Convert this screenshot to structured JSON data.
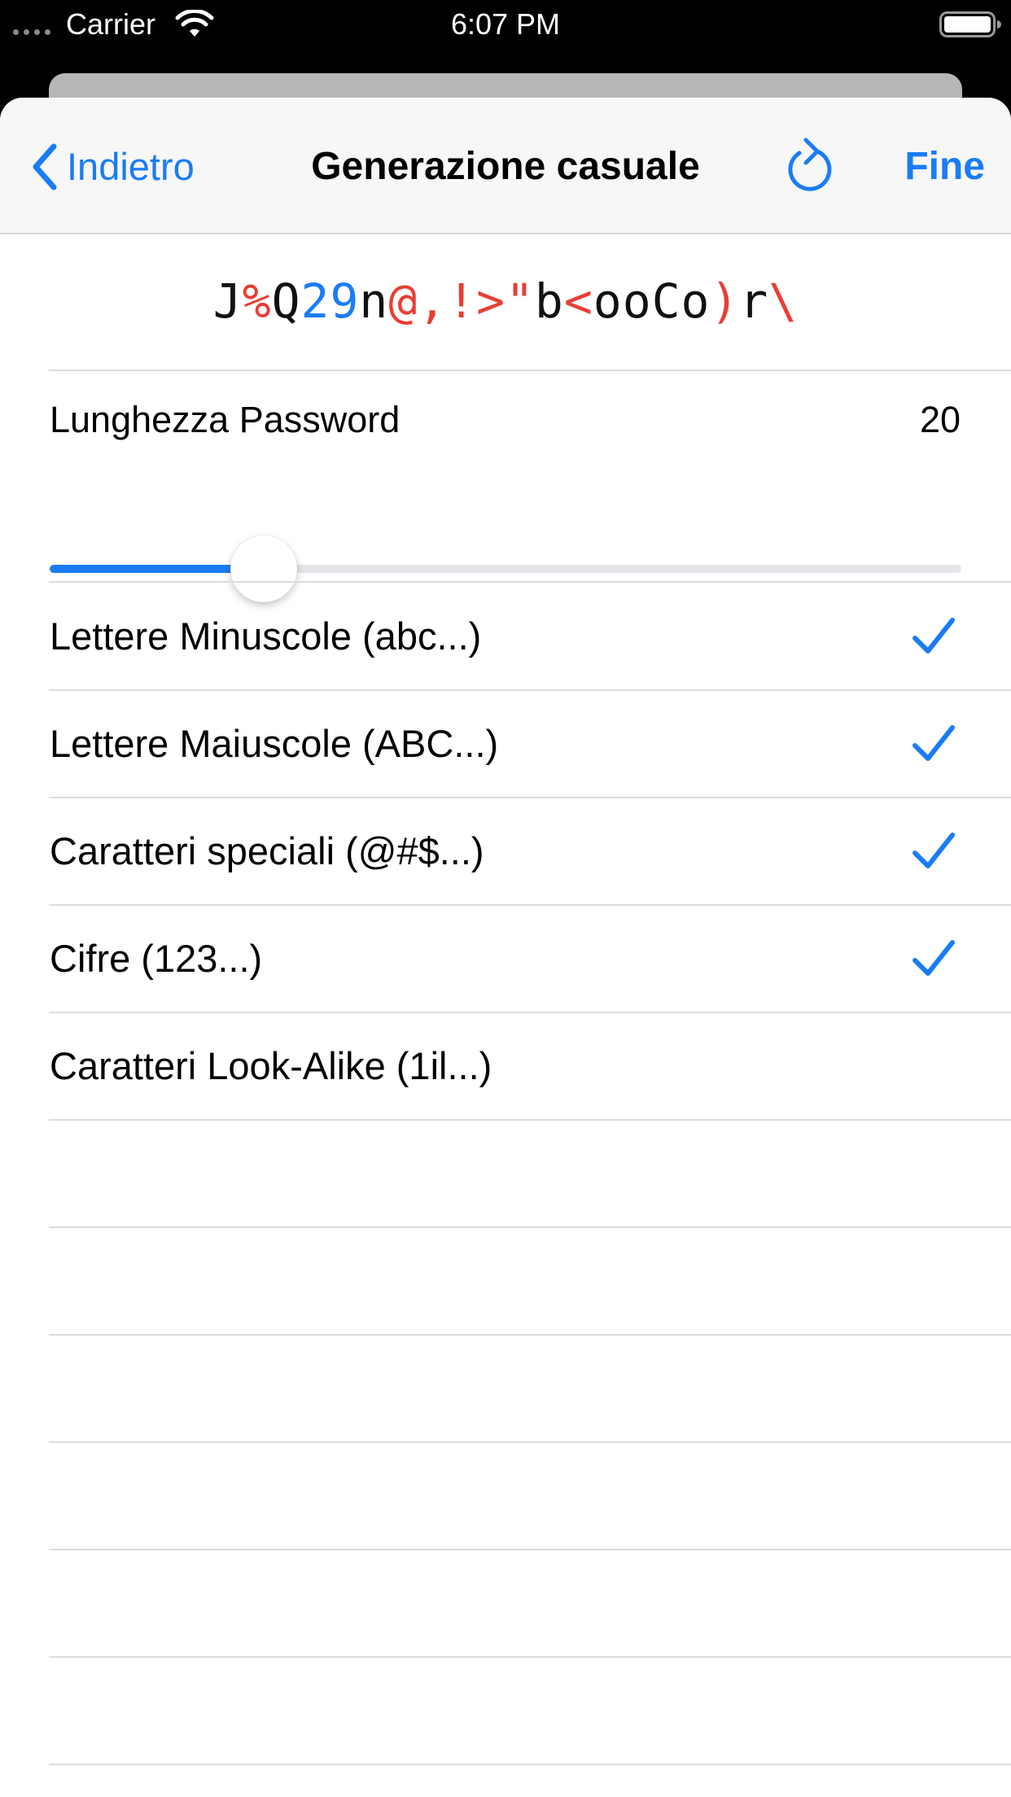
{
  "status_bar": {
    "carrier": "Carrier",
    "time": "6:07 PM",
    "wifi_icon": "wifi-icon",
    "battery_icon": "battery-icon"
  },
  "nav": {
    "back_label": "Indietro",
    "title": "Generazione casuale",
    "refresh_icon": "refresh-icon",
    "done_label": "Fine"
  },
  "password": {
    "value": "J%Q29n@,!>\"b<ooCo)r\\",
    "colors": {
      "letter": "#111111",
      "special": "#ea3d34",
      "digit": "#1a7cf6"
    }
  },
  "length": {
    "label": "Lunghezza Password",
    "value": "20",
    "slider_fraction": 0.235
  },
  "options": [
    {
      "label": "Lettere Minuscole (abc...)",
      "checked": true
    },
    {
      "label": "Lettere Maiuscole (ABC...)",
      "checked": true
    },
    {
      "label": "Caratteri speciali (@#$...)",
      "checked": true
    },
    {
      "label": "Cifre (123...)",
      "checked": true
    },
    {
      "label": "Caratteri Look-Alike (1il...)",
      "checked": false
    }
  ],
  "accent_color": "#1a7cf6"
}
